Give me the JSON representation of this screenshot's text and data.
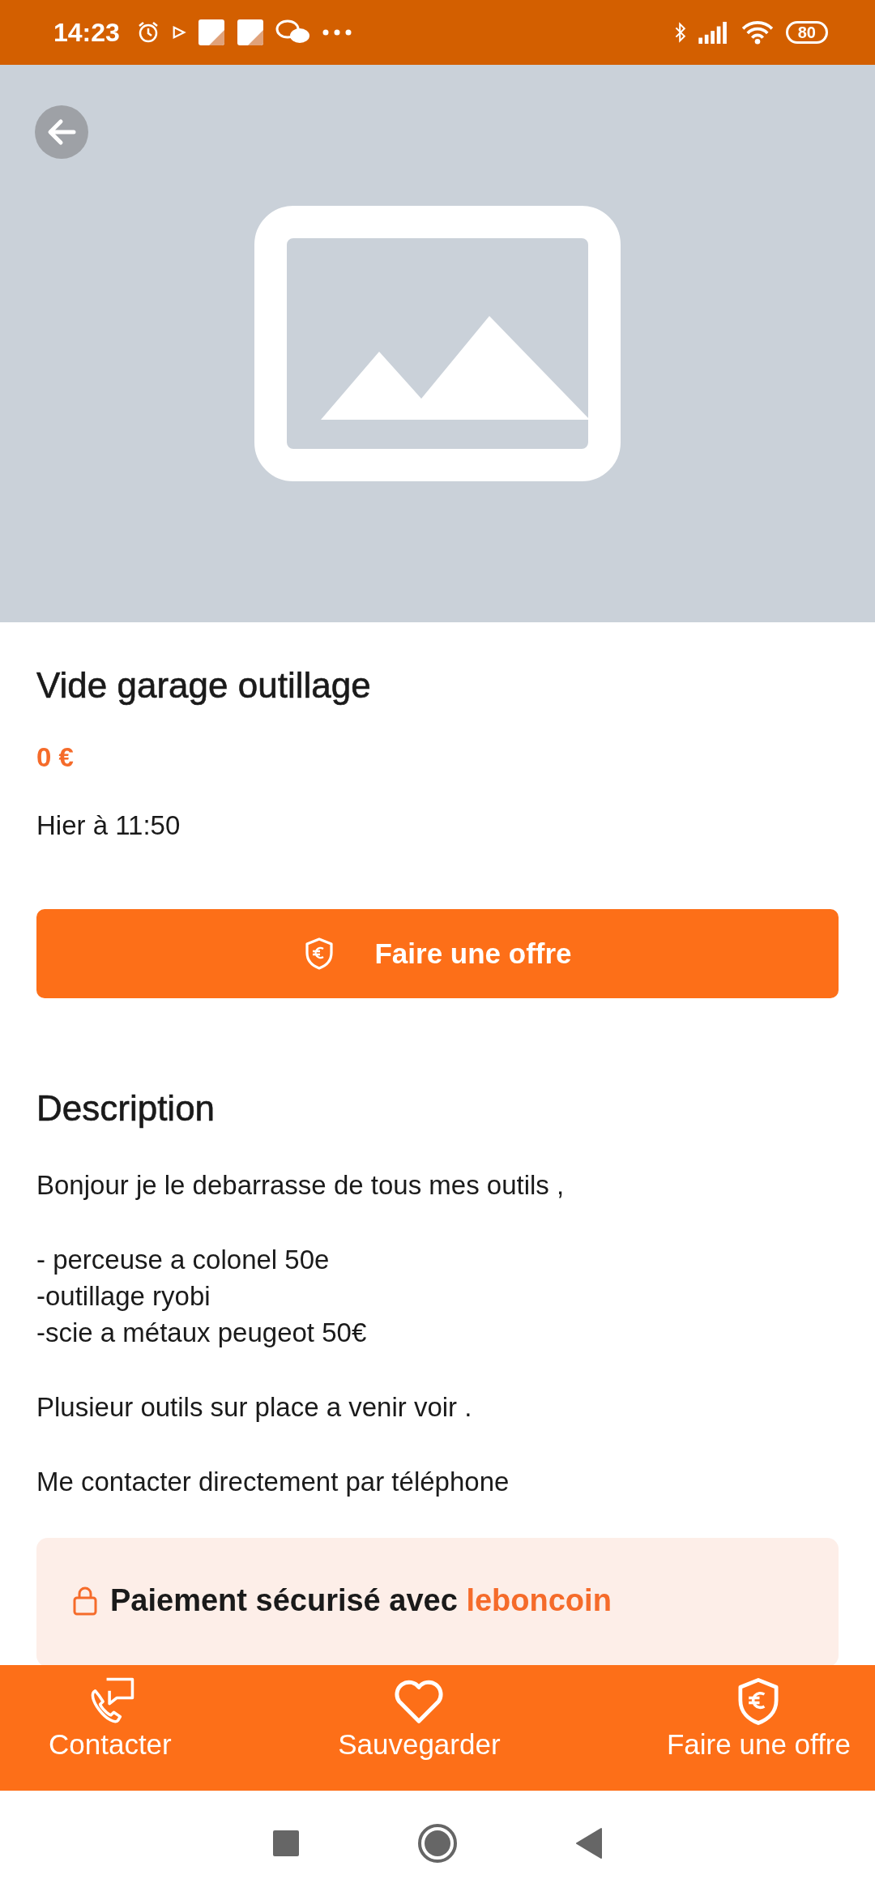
{
  "status_bar": {
    "time": "14:23",
    "battery": "80"
  },
  "ad": {
    "photo": {
      "kind": "placeholder"
    },
    "title": "Vide garage outillage",
    "price": "0 €",
    "date": "Hier à 11:50"
  },
  "offer_button": {
    "label": "Faire une offre"
  },
  "description": {
    "heading": "Description",
    "paragraphs": [
      "Bonjour je le debarrasse de tous mes outils ,",
      "- perceuse a colonel 50e\n-outillage ryobi\n-scie a métaux peugeot 50€",
      "Plusieur outils sur place a venir voir .",
      "Me contacter directement par téléphone"
    ]
  },
  "secure_payment": {
    "text": "Paiement sécurisé avec ",
    "brand": "leboncoin"
  },
  "bottom_bar": [
    {
      "kind": "contact",
      "label": "Contacter"
    },
    {
      "kind": "save",
      "label": "Sauvegarder"
    },
    {
      "kind": "offer",
      "label": "Faire une offre"
    }
  ]
}
